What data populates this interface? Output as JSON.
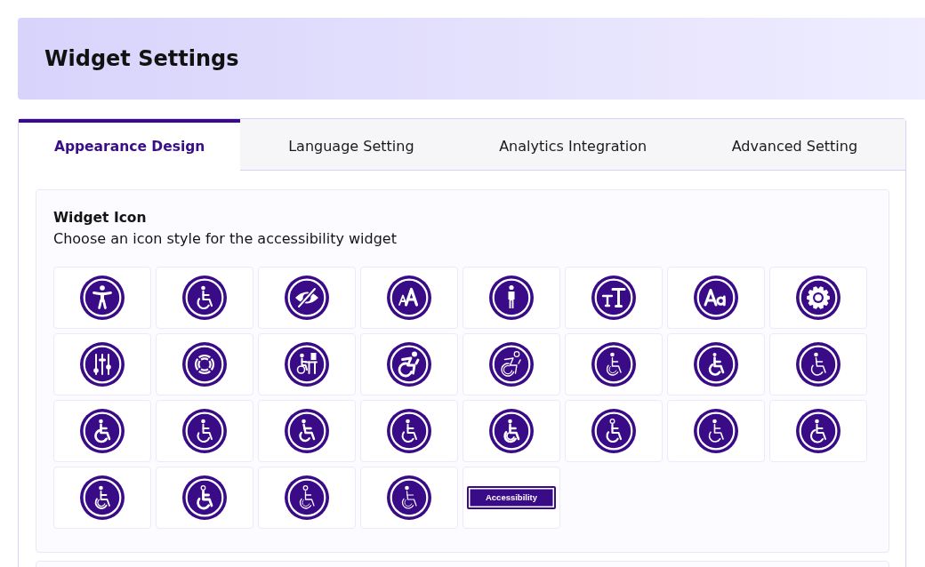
{
  "header": {
    "title": "Widget Settings"
  },
  "tabs": [
    {
      "label": "Appearance Design",
      "selected": true
    },
    {
      "label": "Language Setting",
      "selected": false
    },
    {
      "label": "Analytics Integration",
      "selected": false
    },
    {
      "label": "Advanced Setting",
      "selected": false
    }
  ],
  "widget_icon": {
    "title": "Widget Icon",
    "description": "Choose an icon style for the accessibility widget",
    "options": [
      {
        "kind": "figure"
      },
      {
        "kind": "wheelchair"
      },
      {
        "kind": "eyeslash"
      },
      {
        "kind": "textsize"
      },
      {
        "kind": "person"
      },
      {
        "kind": "textheight"
      },
      {
        "kind": "lettercase"
      },
      {
        "kind": "gear"
      },
      {
        "kind": "sliders"
      },
      {
        "kind": "lifebuoy"
      },
      {
        "kind": "workstation"
      },
      {
        "kind": "dynamic"
      },
      {
        "kind": "dynamicoutline"
      },
      {
        "kind": "chairoutline"
      },
      {
        "kind": "chairsmall"
      },
      {
        "kind": "chairthin"
      },
      {
        "kind": "chairbold"
      },
      {
        "kind": "chairopen"
      },
      {
        "kind": "chairlean"
      },
      {
        "kind": "chairclassic"
      },
      {
        "kind": "chairswoosh"
      },
      {
        "kind": "chairsimple"
      },
      {
        "kind": "chairline"
      },
      {
        "kind": "chairround"
      },
      {
        "kind": "chairarc"
      },
      {
        "kind": "chaircurve"
      },
      {
        "kind": "chairspoked"
      },
      {
        "kind": "chairframe"
      },
      {
        "kind": "label",
        "text": "Accessibility"
      }
    ]
  }
}
